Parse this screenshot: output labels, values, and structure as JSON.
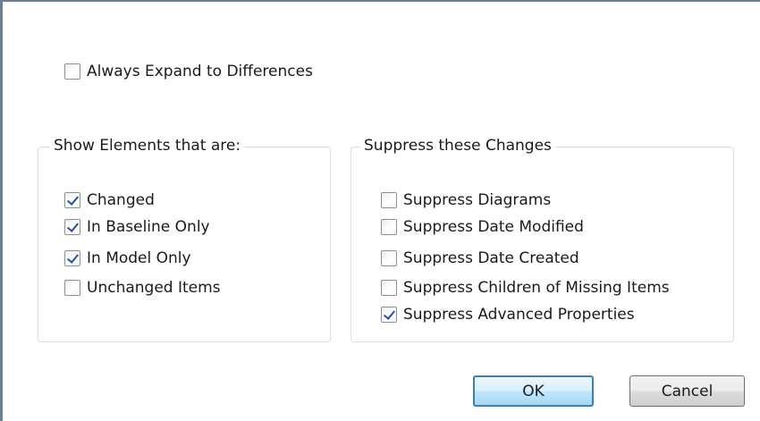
{
  "options": {
    "always_expand": {
      "label": "Always Expand to Differences",
      "checked": false
    }
  },
  "show_group": {
    "title": "Show Elements that are:",
    "items": [
      {
        "label": "Changed",
        "checked": true
      },
      {
        "label": "In Baseline Only",
        "checked": true
      },
      {
        "label": "In Model Only",
        "checked": true
      },
      {
        "label": "Unchanged Items",
        "checked": false
      }
    ]
  },
  "suppress_group": {
    "title": "Suppress these Changes",
    "items": [
      {
        "label": "Suppress Diagrams",
        "checked": false
      },
      {
        "label": "Suppress Date Modified",
        "checked": false
      },
      {
        "label": "Suppress Date Created",
        "checked": false
      },
      {
        "label": "Suppress Children of Missing Items",
        "checked": false
      },
      {
        "label": "Suppress Advanced Properties",
        "checked": true
      }
    ]
  },
  "buttons": {
    "ok": "OK",
    "cancel": "Cancel"
  },
  "colors": {
    "check_mark": "#274fa4",
    "ok_border": "#3c7fb1",
    "group_border": "#d5dfe5"
  }
}
